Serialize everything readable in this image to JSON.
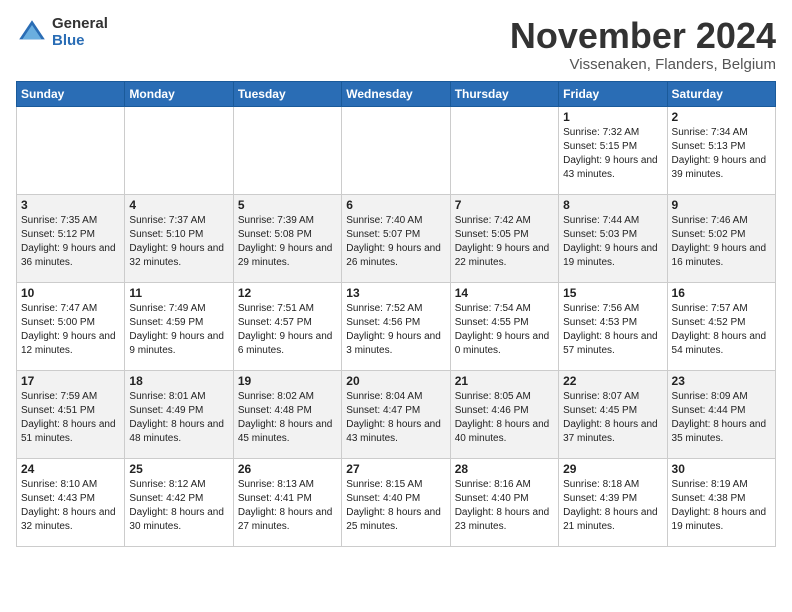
{
  "header": {
    "logo_general": "General",
    "logo_blue": "Blue",
    "month_title": "November 2024",
    "location": "Vissenaken, Flanders, Belgium"
  },
  "days_of_week": [
    "Sunday",
    "Monday",
    "Tuesday",
    "Wednesday",
    "Thursday",
    "Friday",
    "Saturday"
  ],
  "weeks": [
    [
      {
        "day": "",
        "info": ""
      },
      {
        "day": "",
        "info": ""
      },
      {
        "day": "",
        "info": ""
      },
      {
        "day": "",
        "info": ""
      },
      {
        "day": "",
        "info": ""
      },
      {
        "day": "1",
        "info": "Sunrise: 7:32 AM\nSunset: 5:15 PM\nDaylight: 9 hours and 43 minutes."
      },
      {
        "day": "2",
        "info": "Sunrise: 7:34 AM\nSunset: 5:13 PM\nDaylight: 9 hours and 39 minutes."
      }
    ],
    [
      {
        "day": "3",
        "info": "Sunrise: 7:35 AM\nSunset: 5:12 PM\nDaylight: 9 hours and 36 minutes."
      },
      {
        "day": "4",
        "info": "Sunrise: 7:37 AM\nSunset: 5:10 PM\nDaylight: 9 hours and 32 minutes."
      },
      {
        "day": "5",
        "info": "Sunrise: 7:39 AM\nSunset: 5:08 PM\nDaylight: 9 hours and 29 minutes."
      },
      {
        "day": "6",
        "info": "Sunrise: 7:40 AM\nSunset: 5:07 PM\nDaylight: 9 hours and 26 minutes."
      },
      {
        "day": "7",
        "info": "Sunrise: 7:42 AM\nSunset: 5:05 PM\nDaylight: 9 hours and 22 minutes."
      },
      {
        "day": "8",
        "info": "Sunrise: 7:44 AM\nSunset: 5:03 PM\nDaylight: 9 hours and 19 minutes."
      },
      {
        "day": "9",
        "info": "Sunrise: 7:46 AM\nSunset: 5:02 PM\nDaylight: 9 hours and 16 minutes."
      }
    ],
    [
      {
        "day": "10",
        "info": "Sunrise: 7:47 AM\nSunset: 5:00 PM\nDaylight: 9 hours and 12 minutes."
      },
      {
        "day": "11",
        "info": "Sunrise: 7:49 AM\nSunset: 4:59 PM\nDaylight: 9 hours and 9 minutes."
      },
      {
        "day": "12",
        "info": "Sunrise: 7:51 AM\nSunset: 4:57 PM\nDaylight: 9 hours and 6 minutes."
      },
      {
        "day": "13",
        "info": "Sunrise: 7:52 AM\nSunset: 4:56 PM\nDaylight: 9 hours and 3 minutes."
      },
      {
        "day": "14",
        "info": "Sunrise: 7:54 AM\nSunset: 4:55 PM\nDaylight: 9 hours and 0 minutes."
      },
      {
        "day": "15",
        "info": "Sunrise: 7:56 AM\nSunset: 4:53 PM\nDaylight: 8 hours and 57 minutes."
      },
      {
        "day": "16",
        "info": "Sunrise: 7:57 AM\nSunset: 4:52 PM\nDaylight: 8 hours and 54 minutes."
      }
    ],
    [
      {
        "day": "17",
        "info": "Sunrise: 7:59 AM\nSunset: 4:51 PM\nDaylight: 8 hours and 51 minutes."
      },
      {
        "day": "18",
        "info": "Sunrise: 8:01 AM\nSunset: 4:49 PM\nDaylight: 8 hours and 48 minutes."
      },
      {
        "day": "19",
        "info": "Sunrise: 8:02 AM\nSunset: 4:48 PM\nDaylight: 8 hours and 45 minutes."
      },
      {
        "day": "20",
        "info": "Sunrise: 8:04 AM\nSunset: 4:47 PM\nDaylight: 8 hours and 43 minutes."
      },
      {
        "day": "21",
        "info": "Sunrise: 8:05 AM\nSunset: 4:46 PM\nDaylight: 8 hours and 40 minutes."
      },
      {
        "day": "22",
        "info": "Sunrise: 8:07 AM\nSunset: 4:45 PM\nDaylight: 8 hours and 37 minutes."
      },
      {
        "day": "23",
        "info": "Sunrise: 8:09 AM\nSunset: 4:44 PM\nDaylight: 8 hours and 35 minutes."
      }
    ],
    [
      {
        "day": "24",
        "info": "Sunrise: 8:10 AM\nSunset: 4:43 PM\nDaylight: 8 hours and 32 minutes."
      },
      {
        "day": "25",
        "info": "Sunrise: 8:12 AM\nSunset: 4:42 PM\nDaylight: 8 hours and 30 minutes."
      },
      {
        "day": "26",
        "info": "Sunrise: 8:13 AM\nSunset: 4:41 PM\nDaylight: 8 hours and 27 minutes."
      },
      {
        "day": "27",
        "info": "Sunrise: 8:15 AM\nSunset: 4:40 PM\nDaylight: 8 hours and 25 minutes."
      },
      {
        "day": "28",
        "info": "Sunrise: 8:16 AM\nSunset: 4:40 PM\nDaylight: 8 hours and 23 minutes."
      },
      {
        "day": "29",
        "info": "Sunrise: 8:18 AM\nSunset: 4:39 PM\nDaylight: 8 hours and 21 minutes."
      },
      {
        "day": "30",
        "info": "Sunrise: 8:19 AM\nSunset: 4:38 PM\nDaylight: 8 hours and 19 minutes."
      }
    ]
  ]
}
